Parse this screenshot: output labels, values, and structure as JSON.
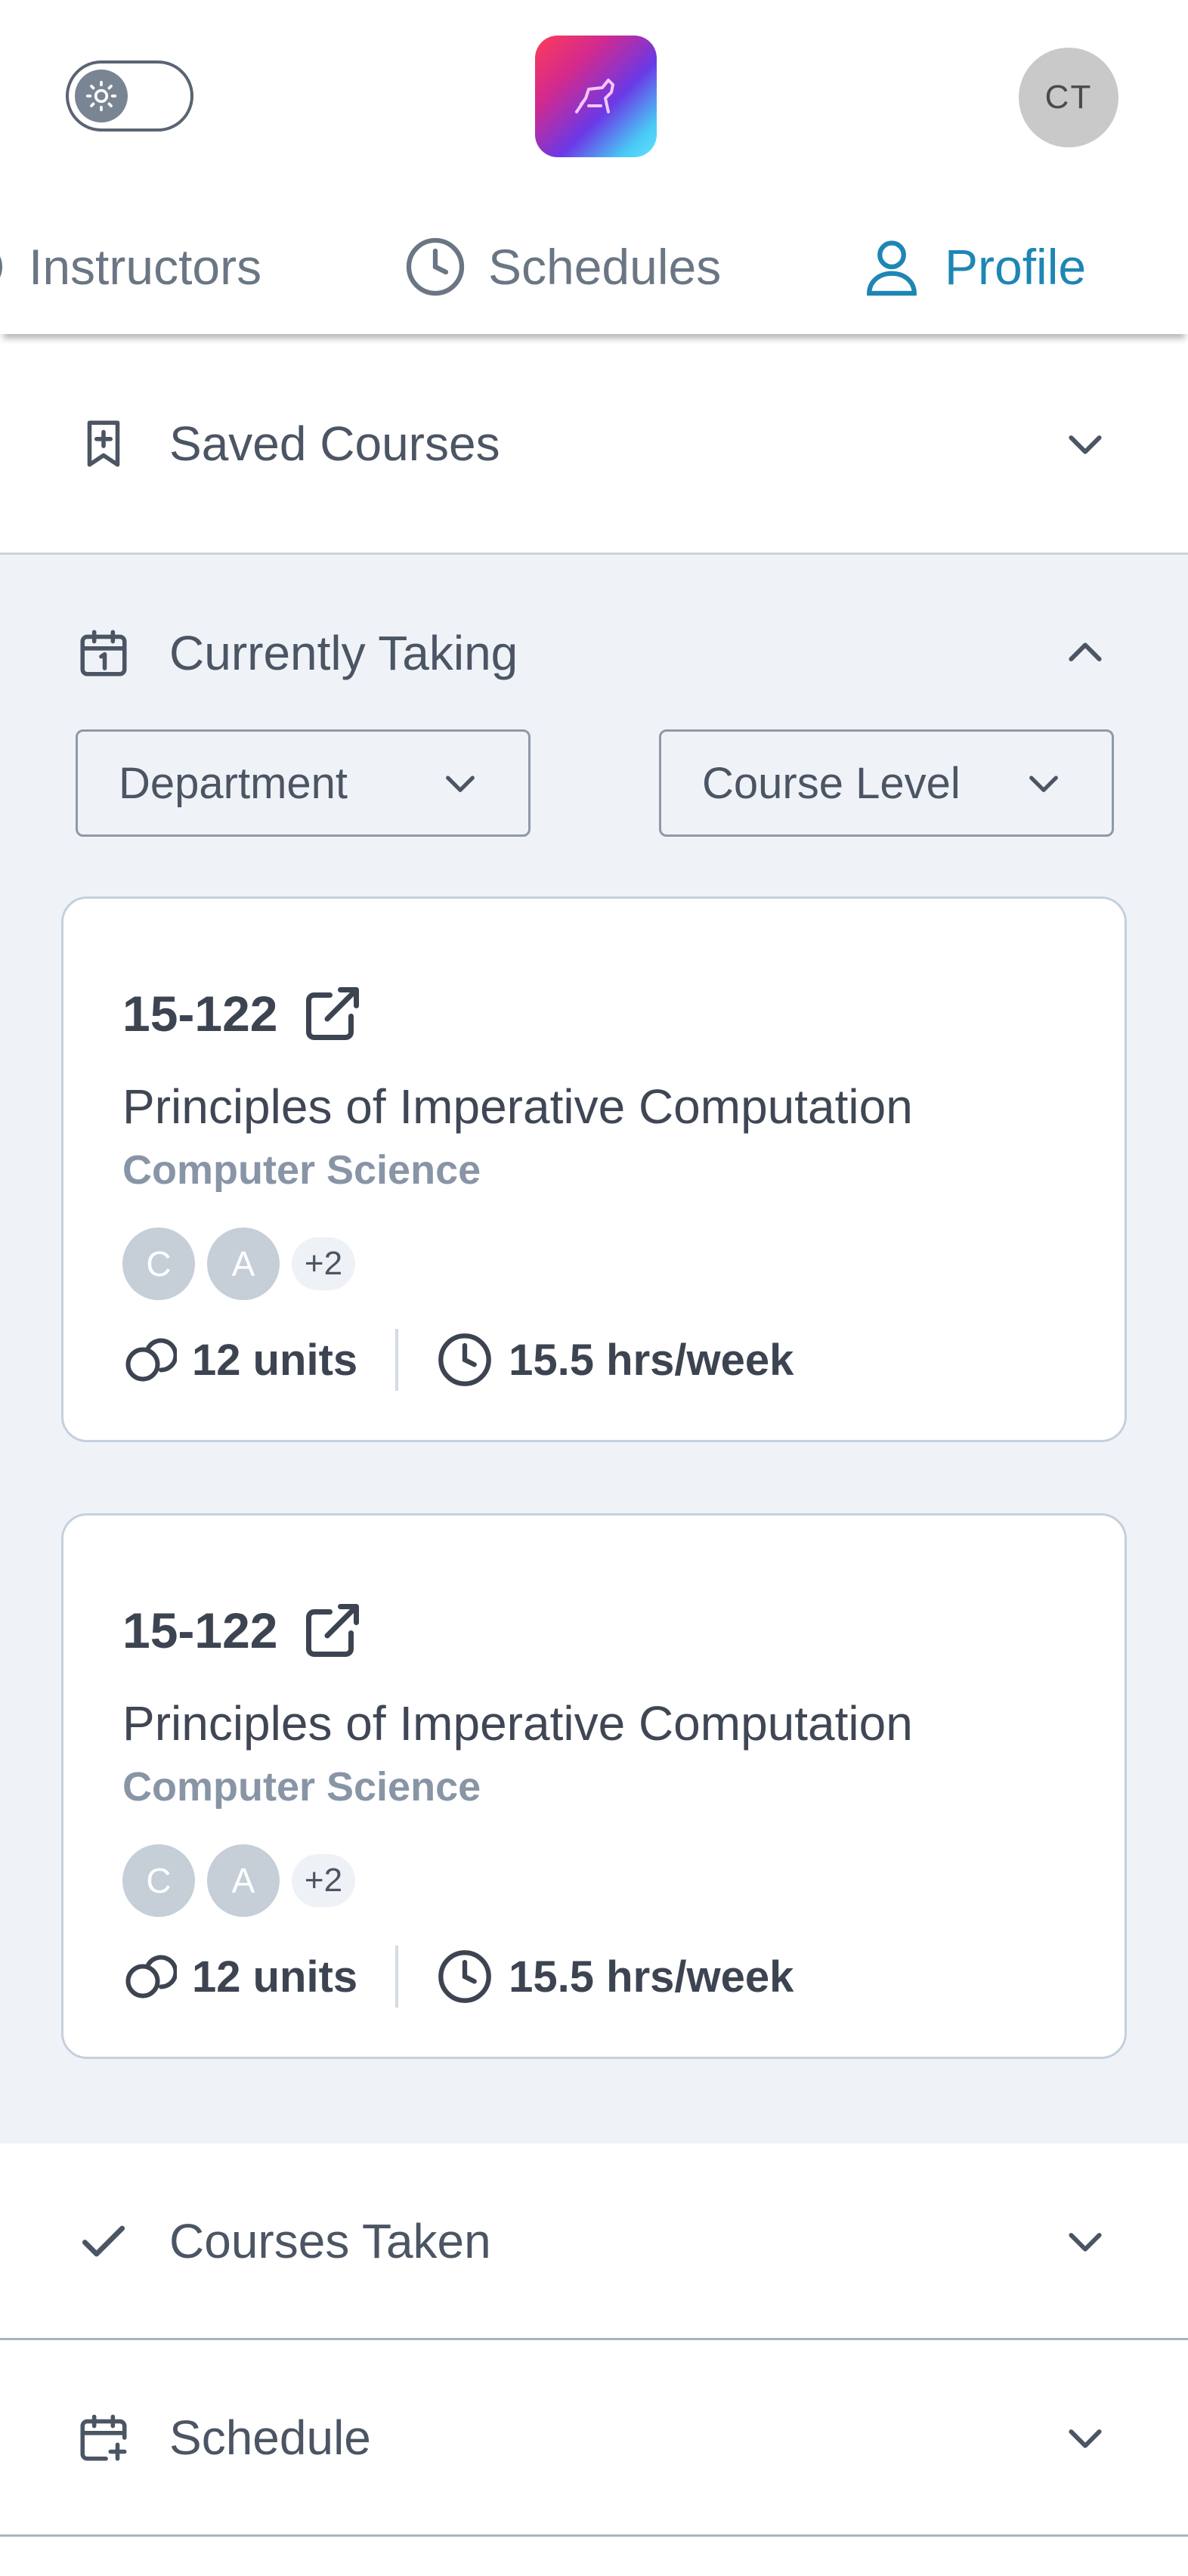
{
  "header": {
    "theme_toggle": {
      "icon": "sun-icon",
      "state": "light"
    },
    "logo": {
      "icon": "app-logo-icon"
    },
    "user_initials": "CT"
  },
  "nav": {
    "tabs": [
      {
        "label": "Instructors",
        "icon": "instructors-icon",
        "active": false
      },
      {
        "label": "Schedules",
        "icon": "clock-icon",
        "active": false
      },
      {
        "label": "Profile",
        "icon": "user-icon",
        "active": true
      }
    ],
    "active_color": "#1d86b5"
  },
  "sections": {
    "saved": {
      "title": "Saved Courses",
      "icon": "bookmark-plus-icon",
      "expanded": false
    },
    "current": {
      "title": "Currently Taking",
      "icon": "calendar-icon",
      "expanded": true,
      "filters": {
        "department": "Department",
        "level": "Course Level"
      },
      "courses": [
        {
          "code": "15-122",
          "name": "Principles of Imperative Computation",
          "department": "Computer Science",
          "instructors": [
            "C",
            "A"
          ],
          "more_instructors": "+2",
          "units": "12 units",
          "hours": "15.5 hrs/week"
        },
        {
          "code": "15-122",
          "name": "Principles of Imperative Computation",
          "department": "Computer Science",
          "instructors": [
            "C",
            "A"
          ],
          "more_instructors": "+2",
          "units": "12 units",
          "hours": "15.5 hrs/week"
        }
      ]
    },
    "taken": {
      "title": "Courses Taken",
      "icon": "check-icon",
      "expanded": false
    },
    "schedule": {
      "title": "Schedule",
      "icon": "calendar-plus-icon",
      "expanded": false
    }
  }
}
